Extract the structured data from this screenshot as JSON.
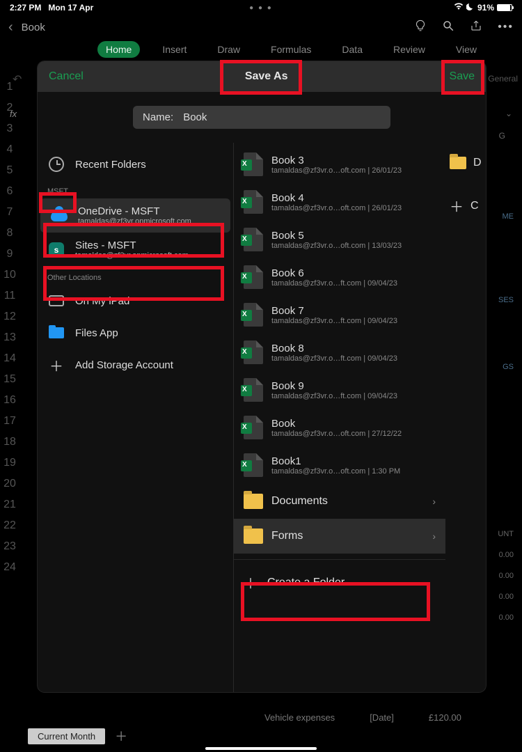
{
  "status": {
    "time": "2:27 PM",
    "date": "Mon 17 Apr",
    "battery": "91%"
  },
  "header": {
    "doc_title": "Book"
  },
  "tabs": [
    "Home",
    "Insert",
    "Draw",
    "Formulas",
    "Data",
    "Review",
    "View"
  ],
  "modal": {
    "cancel": "Cancel",
    "title": "Save As",
    "save": "Save",
    "name_label": "Name:",
    "name_value": "Book"
  },
  "sidebar": {
    "recent": "Recent Folders",
    "group": "MSFT",
    "onedrive": {
      "title": "OneDrive - MSFT",
      "sub": "tamaldas@zf3vr.onmicrosoft.com"
    },
    "sites": {
      "title": "Sites - MSFT",
      "sub": "tamaldas@zf3vr.onmicrosoft.com"
    },
    "other_header": "Other Locations",
    "ipad": "On My iPad",
    "files": "Files App",
    "add": "Add Storage Account"
  },
  "files": [
    {
      "name": "Book 3",
      "meta": "tamaldas@zf3vr.o…oft.com | 26/01/23"
    },
    {
      "name": "Book 4",
      "meta": "tamaldas@zf3vr.o…oft.com | 26/01/23"
    },
    {
      "name": "Book 5",
      "meta": "tamaldas@zf3vr.o…oft.com | 13/03/23"
    },
    {
      "name": "Book 6",
      "meta": "tamaldas@zf3vr.o…ft.com | 09/04/23"
    },
    {
      "name": "Book 7",
      "meta": "tamaldas@zf3vr.o…ft.com | 09/04/23"
    },
    {
      "name": "Book 8",
      "meta": "tamaldas@zf3vr.o…ft.com | 09/04/23"
    },
    {
      "name": "Book 9",
      "meta": "tamaldas@zf3vr.o…ft.com | 09/04/23"
    },
    {
      "name": "Book",
      "meta": "tamaldas@zf3vr.o…oft.com | 27/12/22"
    },
    {
      "name": "Book1",
      "meta": "tamaldas@zf3vr.o…oft.com | 1:30 PM"
    }
  ],
  "folders": {
    "documents": "Documents",
    "forms": "Forms",
    "create": "Create a Folder"
  },
  "right": {
    "d": "D",
    "c": "C"
  },
  "sheet": {
    "tab": "Current Month",
    "bg_label": "General",
    "col": "G",
    "fx": "fx",
    "bottom": {
      "a": "Vehicle expenses",
      "b": "[Date]",
      "c": "£120.00"
    },
    "faint": [
      "ME",
      "SES",
      "GS",
      "UNT",
      "0.00",
      "0.00",
      "0.00",
      "0.00"
    ]
  }
}
